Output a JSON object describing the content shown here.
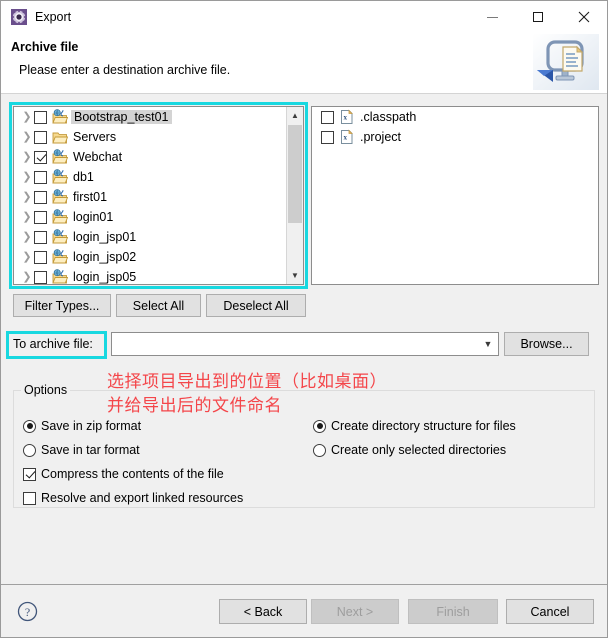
{
  "window": {
    "title": "Export",
    "icon": "export-gear-icon",
    "controls": {
      "minimize": "minimize-icon",
      "maximize": "maximize-icon",
      "close": "close-icon"
    }
  },
  "header": {
    "title": "Archive file",
    "description": "Please enter a destination archive file.",
    "banner_icon": "archive-export-banner-icon"
  },
  "tree": {
    "items": [
      {
        "label": "Bootstrap_test01",
        "checked": false,
        "selected": true,
        "icon": "java-project-folder-icon",
        "expandable": true
      },
      {
        "label": "Servers",
        "checked": false,
        "selected": false,
        "icon": "folder-icon",
        "expandable": true
      },
      {
        "label": "Webchat",
        "checked": true,
        "selected": false,
        "icon": "java-project-folder-icon",
        "expandable": true
      },
      {
        "label": "db1",
        "checked": false,
        "selected": false,
        "icon": "java-project-folder-icon",
        "expandable": true
      },
      {
        "label": "first01",
        "checked": false,
        "selected": false,
        "icon": "java-project-folder-icon",
        "expandable": true
      },
      {
        "label": "login01",
        "checked": false,
        "selected": false,
        "icon": "java-project-folder-icon",
        "expandable": true
      },
      {
        "label": "login_jsp01",
        "checked": false,
        "selected": false,
        "icon": "java-project-folder-icon",
        "expandable": true
      },
      {
        "label": "login_jsp02",
        "checked": false,
        "selected": false,
        "icon": "java-project-folder-icon",
        "expandable": true
      },
      {
        "label": "login_jsp05",
        "checked": false,
        "selected": false,
        "icon": "java-project-folder-icon",
        "expandable": true
      }
    ],
    "scrollbar": {
      "up_icon": "chevron-up-icon",
      "down_icon": "chevron-down-icon"
    }
  },
  "files": {
    "items": [
      {
        "label": ".classpath",
        "checked": false,
        "icon": "xml-file-icon"
      },
      {
        "label": ".project",
        "checked": false,
        "icon": "xml-file-icon"
      }
    ]
  },
  "selection_buttons": {
    "filter_types": "Filter Types...",
    "select_all": "Select All",
    "deselect_all": "Deselect All"
  },
  "archive": {
    "label": "To archive file:",
    "value": "",
    "placeholder": "",
    "dropdown_icon": "chevron-down-icon",
    "browse": "Browse..."
  },
  "annotation": {
    "line1": "选择项目导出到的位置（比如桌面）",
    "line2": "并给导出后的文件命名",
    "color": "#f4464a"
  },
  "highlight": {
    "color": "#18d8e0"
  },
  "options": {
    "legend": "Options",
    "left": [
      {
        "type": "radio",
        "label": "Save in zip format",
        "selected": true
      },
      {
        "type": "radio",
        "label": "Save in tar format",
        "selected": false
      },
      {
        "type": "checkbox",
        "label": "Compress the contents of the file",
        "checked": true
      },
      {
        "type": "checkbox",
        "label": "Resolve and export linked resources",
        "checked": false
      }
    ],
    "right": [
      {
        "type": "radio",
        "label": "Create directory structure for files",
        "selected": true
      },
      {
        "type": "radio",
        "label": "Create only selected directories",
        "selected": false
      }
    ]
  },
  "footer": {
    "help_icon": "help-question-icon",
    "buttons": [
      {
        "label": "< Back",
        "enabled": true
      },
      {
        "label": "Next >",
        "enabled": false
      },
      {
        "label": "Finish",
        "enabled": false
      },
      {
        "label": "Cancel",
        "enabled": true
      }
    ]
  }
}
